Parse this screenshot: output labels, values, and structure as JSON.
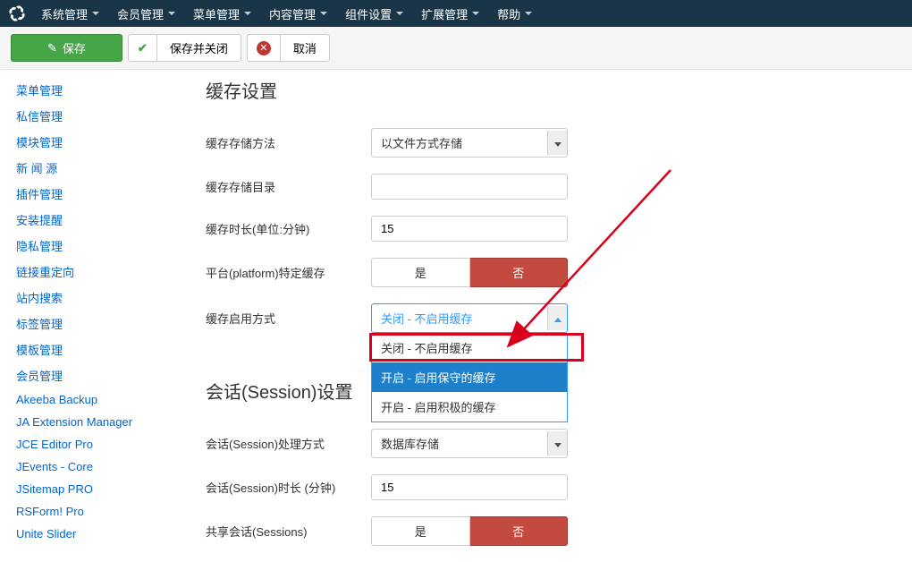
{
  "nav": {
    "items": [
      "系统管理",
      "会员管理",
      "菜单管理",
      "内容管理",
      "组件设置",
      "扩展管理",
      "帮助"
    ]
  },
  "toolbar": {
    "save": "保存",
    "save_close": "保存并关闭",
    "cancel": "取消"
  },
  "sidebar": {
    "items": [
      "菜单管理",
      "私信管理",
      "模块管理",
      "新 闻 源",
      "插件管理",
      "安装提醒",
      "隐私管理",
      "链接重定向",
      "站内搜索",
      "标签管理",
      "模板管理",
      "会员管理",
      "Akeeba Backup",
      "JA Extension Manager",
      "JCE Editor Pro",
      "JEvents - Core",
      "JSitemap PRO",
      "RSForm! Pro",
      "Unite Slider"
    ]
  },
  "sections": {
    "cache_title": "缓存设置",
    "session_title": "会话(Session)设置"
  },
  "fields": {
    "cache_handler_label": "缓存存储方法",
    "cache_handler_value": "以文件方式存储",
    "cache_path_label": "缓存存储目录",
    "cache_path_value": "",
    "cache_time_label": "缓存时长(单位:分钟)",
    "cache_time_value": "15",
    "cache_platform_label": "平台(platform)特定缓存",
    "cache_enable_label": "缓存启用方式",
    "cache_enable_value": "关闭 - 不启用缓存",
    "cache_enable_options": [
      "关闭 - 不启用缓存",
      "开启 - 启用保守的缓存",
      "开启 - 启用积极的缓存"
    ],
    "session_handler_label": "会话(Session)处理方式",
    "session_handler_value": "数据库存储",
    "session_time_label": "会话(Session)时长 (分钟)",
    "session_time_value": "15",
    "session_shared_label": "共享会话(Sessions)",
    "yes": "是",
    "no": "否"
  },
  "highlight": {
    "selected_option_index": 1
  }
}
